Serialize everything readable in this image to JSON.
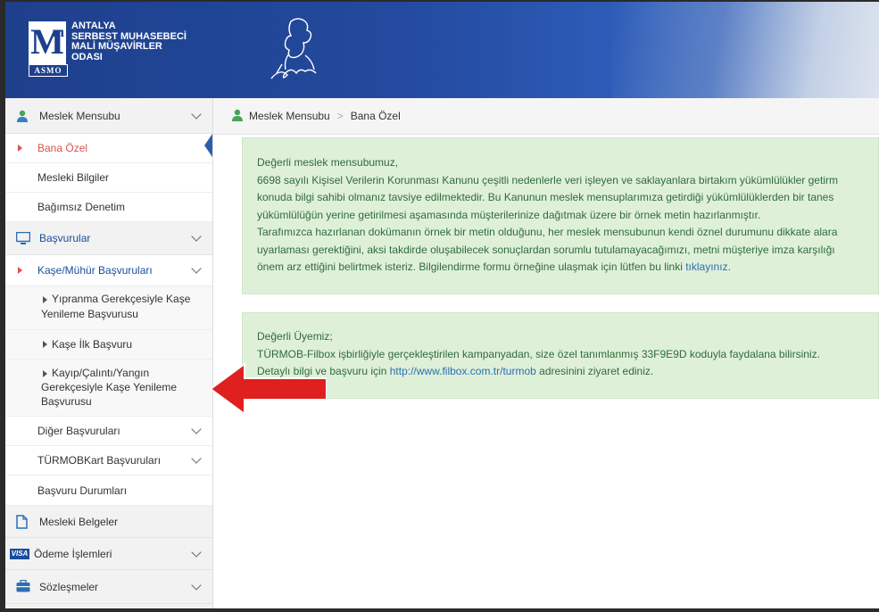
{
  "logo": {
    "mark": "M",
    "mark_sup": "m",
    "badge": "ASMO",
    "lines": [
      "ANTALYA",
      "SERBEST MUHASEBECİ",
      "MALİ MÜŞAVİRLER",
      "ODASI"
    ]
  },
  "sidebar": {
    "items": [
      {
        "label": "Meslek Mensubu",
        "icon": "user-icon",
        "expandable": true
      },
      {
        "label": "Bana Özel",
        "active": true
      },
      {
        "label": "Mesleki Bilgiler"
      },
      {
        "label": "Bağımsız Denetim"
      },
      {
        "label": "Başvurular",
        "icon": "monitor-icon",
        "expandable": true
      },
      {
        "label": "Kaşe/Mühür Başvuruları",
        "expandable": true
      },
      {
        "label": "Yıpranma Gerekçesiyle Kaşe",
        "label2": "Yenileme Başvurusu"
      },
      {
        "label": "Kaşe İlk Başvuru"
      },
      {
        "label": "Kayıp/Çalıntı/Yangın",
        "label2": "Gerekçesiyle Kaşe Yenileme",
        "label3": "Başvurusu"
      },
      {
        "label": "Diğer Başvuruları",
        "expandable": true
      },
      {
        "label": "TÜRMOBKart Başvuruları",
        "expandable": true
      },
      {
        "label": "Başvuru Durumları"
      },
      {
        "label": "Mesleki Belgeler",
        "icon": "document-icon"
      },
      {
        "label": "Ödeme İşlemleri",
        "icon": "visa-card-icon",
        "icon_text": "VISA",
        "expandable": true
      },
      {
        "label": "Sözleşmeler",
        "icon": "briefcase-icon",
        "expandable": true
      }
    ]
  },
  "breadcrumb": {
    "root": "Meslek Mensubu",
    "separator": ">",
    "current": "Bana Özel"
  },
  "notice1": {
    "greeting": "Değerli meslek mensubumuz,",
    "line1": "6698 sayılı Kişisel Verilerin Korunması Kanunu çeşitli nedenlerle veri işleyen ve saklayanlara birtakım yükümlülükler getirm",
    "line2": "konuda bilgi sahibi olmanız tavsiye edilmektedir. Bu Kanunun meslek mensuplarımıza getirdiği yükümlülüklerden bir tanes",
    "line3": "yükümlülüğün yerine getirilmesi aşamasında müşterilerinize dağıtmak üzere bir örnek metin hazırlanmıştır.",
    "line4": "Tarafımızca hazırlanan dokümanın örnek bir metin olduğunu, her meslek mensubunun kendi öznel durumunu dikkate alara",
    "line5": "uyarlaması gerektiğini, aksi takdirde oluşabilecek sonuçlardan sorumlu tutulamayacağımızı, metni müşteriye imza karşılığı",
    "line6": "önem arz ettiğini belirtmek isteriz. Bilgilendirme formu örneğine ulaşmak için lütfen bu linki",
    "link": "tıklayınız",
    "line6_end": "."
  },
  "notice2": {
    "greeting": "Değerli Üyemiz;",
    "line1": "TÜRMOB-Filbox işbirliğiyle gerçekleştirilen kampanyadan, size özel tanımlanmış 33F9E9D koduyla faydalana bilirsiniz.",
    "line2_pre": "Detaylı bilgi ve başvuru için",
    "link": "http://www.filbox.com.tr/turmob",
    "line2_post": "adresinini ziyaret ediniz."
  },
  "colors": {
    "header_blue": "#1e3f8c",
    "active_red": "#d9534f",
    "notice_green_bg": "#dff0d8",
    "link_blue": "#2a6fb5",
    "arrow_red": "#e0201e"
  }
}
